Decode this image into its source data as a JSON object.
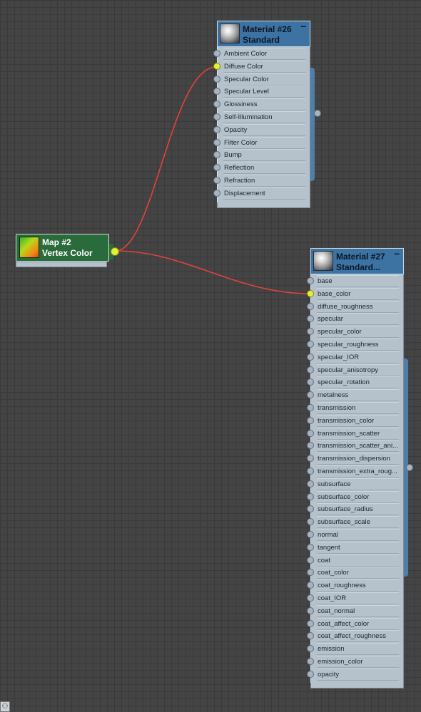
{
  "map_node": {
    "title": "Map #2",
    "subtitle": "Vertex Color",
    "thumb": "vertex-color-swatch",
    "color": "#2a6b3c"
  },
  "material26": {
    "title": "Material #26",
    "subtitle": "Standard",
    "slots": [
      {
        "label": "Ambient Color",
        "connected": false
      },
      {
        "label": "Diffuse Color",
        "connected": true
      },
      {
        "label": "Specular Color",
        "connected": false
      },
      {
        "label": "Specular Level",
        "connected": false
      },
      {
        "label": "Glossiness",
        "connected": false
      },
      {
        "label": "Self-Illumination",
        "connected": false
      },
      {
        "label": "Opacity",
        "connected": false
      },
      {
        "label": "Filter Color",
        "connected": false
      },
      {
        "label": "Bump",
        "connected": false
      },
      {
        "label": "Reflection",
        "connected": false
      },
      {
        "label": "Refraction",
        "connected": false
      },
      {
        "label": "Displacement",
        "connected": false
      }
    ]
  },
  "material27": {
    "title": "Material #27",
    "subtitle": "Standard...",
    "slots": [
      {
        "label": "base",
        "connected": false
      },
      {
        "label": "base_color",
        "connected": true
      },
      {
        "label": "diffuse_roughness",
        "connected": false
      },
      {
        "label": "specular",
        "connected": false
      },
      {
        "label": "specular_color",
        "connected": false
      },
      {
        "label": "specular_roughness",
        "connected": false
      },
      {
        "label": "specular_IOR",
        "connected": false
      },
      {
        "label": "specular_anisotropy",
        "connected": false
      },
      {
        "label": "specular_rotation",
        "connected": false
      },
      {
        "label": "metalness",
        "connected": false
      },
      {
        "label": "transmission",
        "connected": false
      },
      {
        "label": "transmission_color",
        "connected": false
      },
      {
        "label": "transmission_scatter",
        "connected": false
      },
      {
        "label": "transmission_scatter_ani...",
        "connected": false
      },
      {
        "label": "transmission_dispersion",
        "connected": false
      },
      {
        "label": "transmission_extra_roug...",
        "connected": false
      },
      {
        "label": "subsurface",
        "connected": false
      },
      {
        "label": "subsurface_color",
        "connected": false
      },
      {
        "label": "subsurface_radius",
        "connected": false
      },
      {
        "label": "subsurface_scale",
        "connected": false
      },
      {
        "label": "normal",
        "connected": false
      },
      {
        "label": "tangent",
        "connected": false
      },
      {
        "label": "coat",
        "connected": false
      },
      {
        "label": "coat_color",
        "connected": false
      },
      {
        "label": "coat_roughness",
        "connected": false
      },
      {
        "label": "coat_IOR",
        "connected": false
      },
      {
        "label": "coat_normal",
        "connected": false
      },
      {
        "label": "coat_affect_color",
        "connected": false
      },
      {
        "label": "coat_affect_roughness",
        "connected": false
      },
      {
        "label": "emission",
        "connected": false
      },
      {
        "label": "emission_color",
        "connected": false
      },
      {
        "label": "opacity",
        "connected": false
      }
    ]
  },
  "colors": {
    "wire": "#e0433a",
    "socket_connected": "#e1f234",
    "header": "#3d73a3",
    "panel": "#b5c1cb",
    "canvas": "#444444"
  }
}
